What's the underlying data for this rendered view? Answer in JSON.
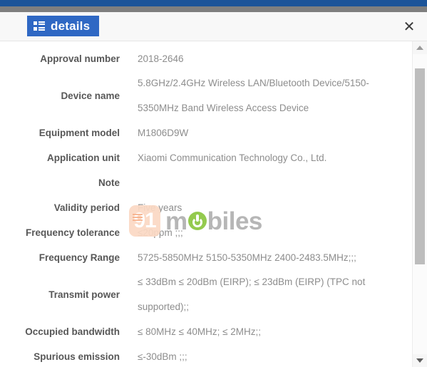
{
  "window": {
    "chrome_bar_color": "#1c5499",
    "chrome_bar2_color": "#7f7f7f"
  },
  "header": {
    "badge_label": "details",
    "badge_color": "#2f68c4",
    "badge_icon": "list-details-icon",
    "close_label": "✕"
  },
  "watermark": {
    "digits": "91",
    "word_before": "m",
    "word_after": "biles",
    "badge_color": "#fbd9c4",
    "accent_color": "#8cc63f",
    "text_color": "#b0b0b0"
  },
  "spec_rows": [
    {
      "label": "Approval number",
      "lines": [
        "2018-2646"
      ]
    },
    {
      "label": "Device name",
      "lines": [
        "5.8GHz/2.4GHz Wireless LAN/Bluetooth Device/5150-",
        "5350MHz Band Wireless Access Device"
      ]
    },
    {
      "label": "Equipment model",
      "lines": [
        "M1806D9W"
      ]
    },
    {
      "label": "Application unit",
      "lines": [
        "Xiaomi Communication Technology Co., Ltd."
      ]
    },
    {
      "label": "Note",
      "lines": [
        ""
      ]
    },
    {
      "label": "Validity period",
      "lines": [
        "Five years"
      ]
    },
    {
      "label": "Frequency tolerance",
      "lines": [
        "≤20ppm ;;;"
      ]
    },
    {
      "label": "Frequency Range",
      "lines": [
        "5725-5850MHz 5150-5350MHz 2400-2483.5MHz;;;"
      ]
    },
    {
      "label": "Transmit power",
      "lines": [
        "≤ 33dBm ≤ 20dBm (EIRP); ≤ 23dBm (EIRP) (TPC not",
        "supported);;"
      ]
    },
    {
      "label": "Occupied bandwidth",
      "lines": [
        "≤ 80MHz ≤ 40MHz; ≤ 2MHz;;"
      ]
    },
    {
      "label": "Spurious emission",
      "lines": [
        "≤-30dBm ;;;"
      ]
    }
  ],
  "scrollbar": {
    "up_arrow": "scroll-up-arrow",
    "down_arrow": "scroll-down-arrow",
    "thumb": "scroll-thumb"
  }
}
